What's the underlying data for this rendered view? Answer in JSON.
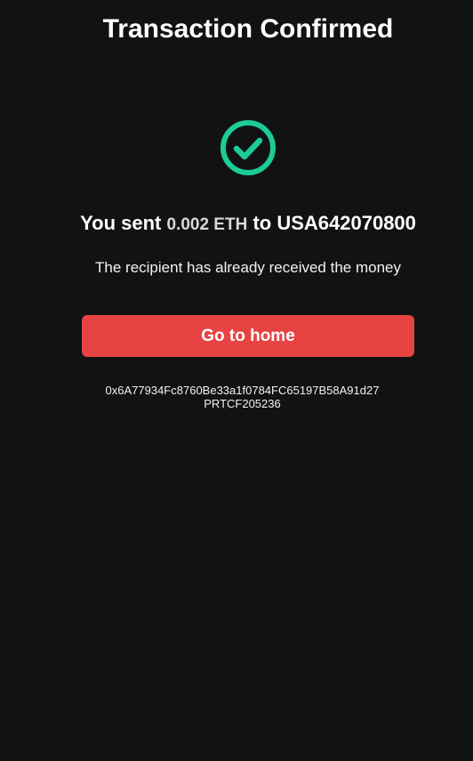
{
  "header": {
    "title": "Transaction Confirmed"
  },
  "status": {
    "icon": "check-circle-icon",
    "color": "#1ccb97"
  },
  "summary": {
    "prefix": "You sent",
    "amount": "0.002 ETH",
    "connector": "to",
    "recipient": "USA642070800"
  },
  "message": "The recipient has already received the money",
  "actions": {
    "home_label": "Go to home",
    "button_color": "#e84343"
  },
  "transaction": {
    "hash": "0x6A77934Fc8760Be33a1f0784FC65197B58A91d27",
    "reference": "PRTCF205236"
  }
}
